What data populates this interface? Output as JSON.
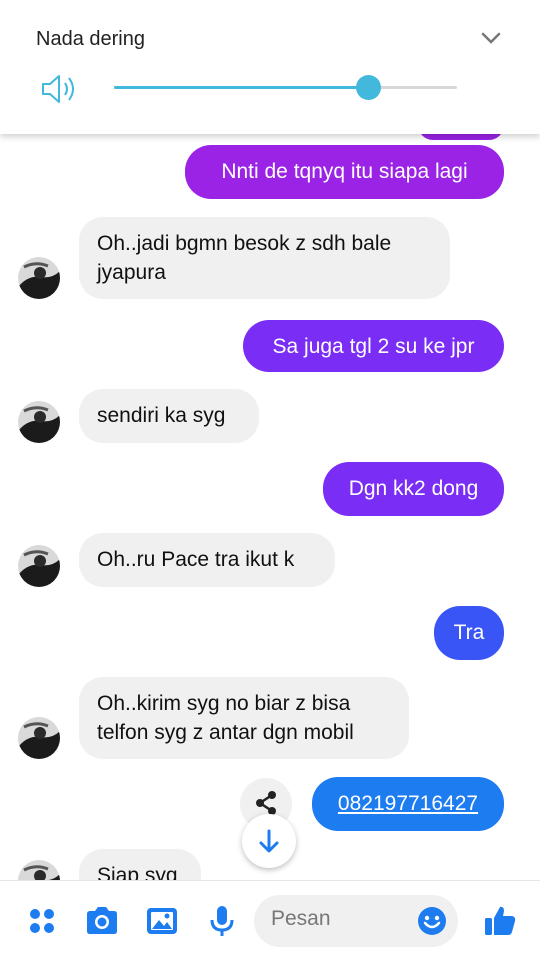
{
  "volume_panel": {
    "title": "Nada dering",
    "level": 0.74,
    "accent_color": "#41b8dc",
    "speaker_icon": "speaker-icon",
    "collapse_icon": "chevron-down-icon"
  },
  "messages": [
    {
      "side": "out",
      "text": "Nnti de tqnyq itu siapa lagi"
    },
    {
      "side": "in",
      "lines": [
        "Oh..jadi bgmn besok z sdh bale",
        "jyapura"
      ]
    },
    {
      "side": "out",
      "text": "Sa juga tgl 2 su ke jpr"
    },
    {
      "side": "in",
      "text": "sendiri ka syg"
    },
    {
      "side": "out",
      "text": "Dgn kk2 dong"
    },
    {
      "side": "in",
      "text": "Oh..ru Pace tra ikut k"
    },
    {
      "side": "out",
      "text": "Tra"
    },
    {
      "side": "in",
      "lines": [
        "Oh..kirim syg no biar z bisa",
        "telfon syg z antar dgn mobil"
      ]
    },
    {
      "side": "out",
      "text": "082197716427"
    },
    {
      "side": "in",
      "text": "Siap syg"
    }
  ],
  "bottom_bar": {
    "placeholder": "Pesan",
    "icons": [
      "apps-icon",
      "camera-icon",
      "gallery-icon",
      "microphone-icon",
      "emoji-icon",
      "thumbs-up-icon"
    ],
    "accent_color": "#1d7cf0"
  },
  "bubble_colors": {
    "incoming": "#f0f0f1",
    "purple": "#9a23e6",
    "violet": "#7a2df5",
    "blue": "#3a55f5",
    "link": "#1d7cf0"
  }
}
